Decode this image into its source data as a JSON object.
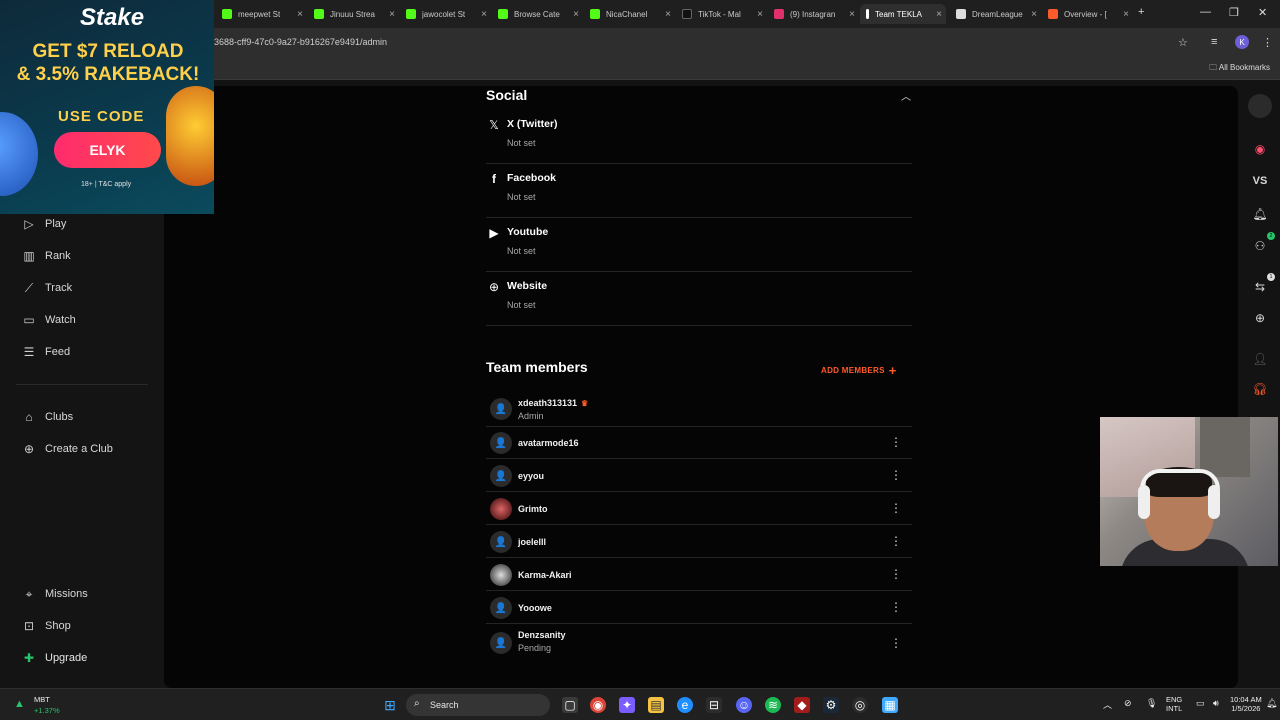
{
  "browser": {
    "tabs": [
      {
        "label": "meepwet St",
        "color": "#53fc18"
      },
      {
        "label": "Jinuuu Strea",
        "color": "#53fc18"
      },
      {
        "label": "jawocolet St",
        "color": "#53fc18"
      },
      {
        "label": "Browse Cate",
        "color": "#53fc18"
      },
      {
        "label": "NicaChanel",
        "color": "#53fc18"
      },
      {
        "label": "TikTok - Mal",
        "color": "#111111"
      },
      {
        "label": "(9) Instagran",
        "color": "#e1306c"
      },
      {
        "label": "Team TEKLA",
        "color": "#ffffff"
      },
      {
        "label": "DreamLeague",
        "color": "#dddddd"
      },
      {
        "label": "Overview - [",
        "color": "#ff5a2a"
      }
    ],
    "url": "3688-cff9-47c0-9a27-b916267e9491/admin",
    "bookmarks_label": "All Bookmarks",
    "profile_initial": "K"
  },
  "ad": {
    "brand": "Stake",
    "headline_1": "GET $7 RELOAD",
    "headline_2": "& 3.5% RAKEBACK!",
    "code_label": "USE CODE",
    "code": "ELYK",
    "fine_print": "18+ | T&C apply"
  },
  "sidebar": {
    "items": [
      {
        "label": "Play",
        "icon": "play-icon"
      },
      {
        "label": "Rank",
        "icon": "rank-icon"
      },
      {
        "label": "Track",
        "icon": "track-icon"
      },
      {
        "label": "Watch",
        "icon": "watch-icon"
      },
      {
        "label": "Feed",
        "icon": "feed-icon"
      }
    ],
    "clubs": [
      {
        "label": "Clubs",
        "icon": "clubs-icon"
      },
      {
        "label": "Create a Club",
        "icon": "plus-circle-icon"
      }
    ],
    "bottom": [
      {
        "label": "Missions",
        "icon": "missions-icon"
      },
      {
        "label": "Shop",
        "icon": "shop-icon"
      },
      {
        "label": "Upgrade",
        "icon": "upgrade-icon"
      }
    ]
  },
  "social": {
    "title": "Social",
    "items": [
      {
        "name": "X (Twitter)",
        "value": "Not set",
        "icon": "x-icon"
      },
      {
        "name": "Facebook",
        "value": "Not set",
        "icon": "facebook-icon"
      },
      {
        "name": "Youtube",
        "value": "Not set",
        "icon": "youtube-icon"
      },
      {
        "name": "Website",
        "value": "Not set",
        "icon": "globe-icon"
      }
    ]
  },
  "team": {
    "title": "Team members",
    "add_label": "ADD MEMBERS",
    "members": [
      {
        "name": "xdeath313131",
        "role": "Admin",
        "owner": true
      },
      {
        "name": "avatarmode16",
        "role": ""
      },
      {
        "name": "eyyou",
        "role": ""
      },
      {
        "name": "Grimto",
        "role": ""
      },
      {
        "name": "joelelll",
        "role": ""
      },
      {
        "name": "Karma-Akari",
        "role": ""
      },
      {
        "name": "Yooowe",
        "role": ""
      },
      {
        "name": "Denzsanity",
        "role": "Pending"
      }
    ]
  },
  "right_rail": {
    "vs_label": "VS",
    "badge_friends": "2",
    "badge_requests": "1"
  },
  "taskbar": {
    "stock_name": "MBT",
    "stock_change": "+1.37%",
    "search_label": "Search",
    "lang_1": "ENG",
    "lang_2": "INTL",
    "time": "10:04 AM",
    "date": "1/5/2026"
  }
}
